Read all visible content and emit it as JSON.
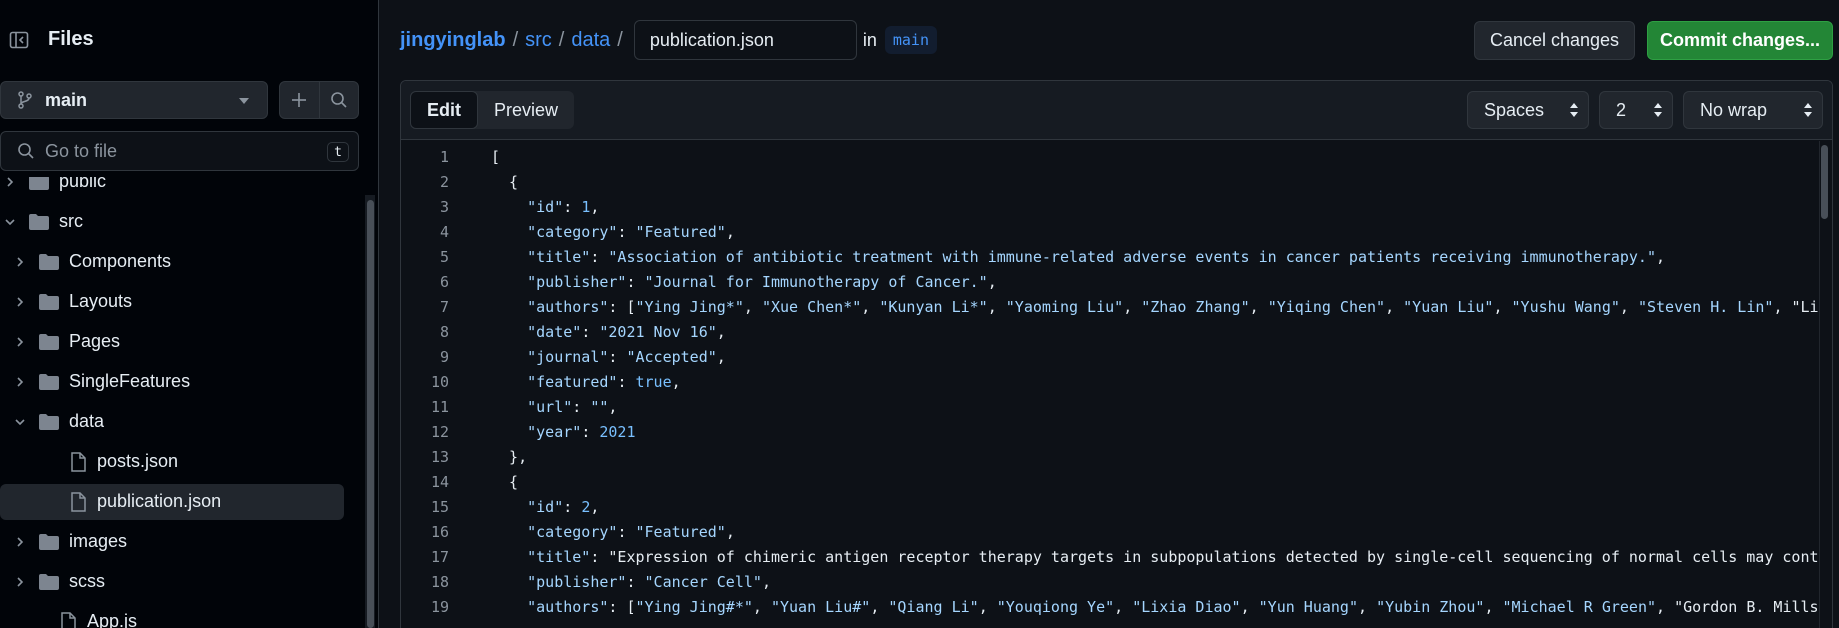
{
  "sidebar": {
    "title": "Files",
    "branch": "main",
    "goto_placeholder": "Go to file",
    "goto_shortcut": "t",
    "tree": [
      {
        "label": "public",
        "type": "folder",
        "depth": 0,
        "open": false
      },
      {
        "label": "src",
        "type": "folder",
        "depth": 0,
        "open": true
      },
      {
        "label": "Components",
        "type": "folder",
        "depth": 1,
        "open": false
      },
      {
        "label": "Layouts",
        "type": "folder",
        "depth": 1,
        "open": false
      },
      {
        "label": "Pages",
        "type": "folder",
        "depth": 1,
        "open": false
      },
      {
        "label": "SingleFeatures",
        "type": "folder",
        "depth": 1,
        "open": false
      },
      {
        "label": "data",
        "type": "folder",
        "depth": 1,
        "open": true
      },
      {
        "label": "posts.json",
        "type": "file",
        "depth": 2
      },
      {
        "label": "publication.json",
        "type": "file",
        "depth": 2,
        "selected": true
      },
      {
        "label": "images",
        "type": "folder",
        "depth": 1,
        "open": false
      },
      {
        "label": "scss",
        "type": "folder",
        "depth": 1,
        "open": false
      },
      {
        "label": "App.js",
        "type": "file",
        "depth": 1
      }
    ]
  },
  "header": {
    "repo": "jingyinglab",
    "path1": "src",
    "path2": "data",
    "filename": "publication.json",
    "in_label": "in",
    "branch": "main",
    "cancel_label": "Cancel changes",
    "commit_label": "Commit changes..."
  },
  "editor": {
    "tabs": [
      "Edit",
      "Preview"
    ],
    "indent_mode": "Spaces",
    "indent_size": "2",
    "wrap_mode": "No wrap",
    "lines": [
      "[",
      "  {",
      "    \"id\": 1,",
      "    \"category\": \"Featured\",",
      "    \"title\": \"Association of antibiotic treatment with immune-related adverse events in cancer patients receiving immunotherapy.\",",
      "    \"publisher\": \"Journal for Immunotherapy of Cancer.\",",
      "    \"authors\": [\"Ying Jing*\", \"Xue Chen*\", \"Kunyan Li*\", \"Yaoming Liu\", \"Zhao Zhang\", \"Yiqing Chen\", \"Yuan Liu\", \"Yushu Wang\", \"Steven H. Lin\", \"Li",
      "    \"date\": \"2021 Nov 16\",",
      "    \"journal\": \"Accepted\",",
      "    \"featured\": true,",
      "    \"url\": \"\",",
      "    \"year\": 2021",
      "  },",
      "  {",
      "    \"id\": 2,",
      "    \"category\": \"Featured\",",
      "    \"title\": \"Expression of chimeric antigen receptor therapy targets in subpopulations detected by single-cell sequencing of normal cells may cont",
      "    \"publisher\": \"Cancer Cell\",",
      "    \"authors\": [\"Ying Jing#*\", \"Yuan Liu#\", \"Qiang Li\", \"Youqiong Ye\", \"Lixia Diao\", \"Yun Huang\", \"Yubin Zhou\", \"Michael R Green\", \"Gordon B. Mills"
    ]
  },
  "colors": {
    "accent": "#4493f8",
    "commit_green": "#238636",
    "string": "#a5d6ff",
    "number": "#79c0ff"
  }
}
